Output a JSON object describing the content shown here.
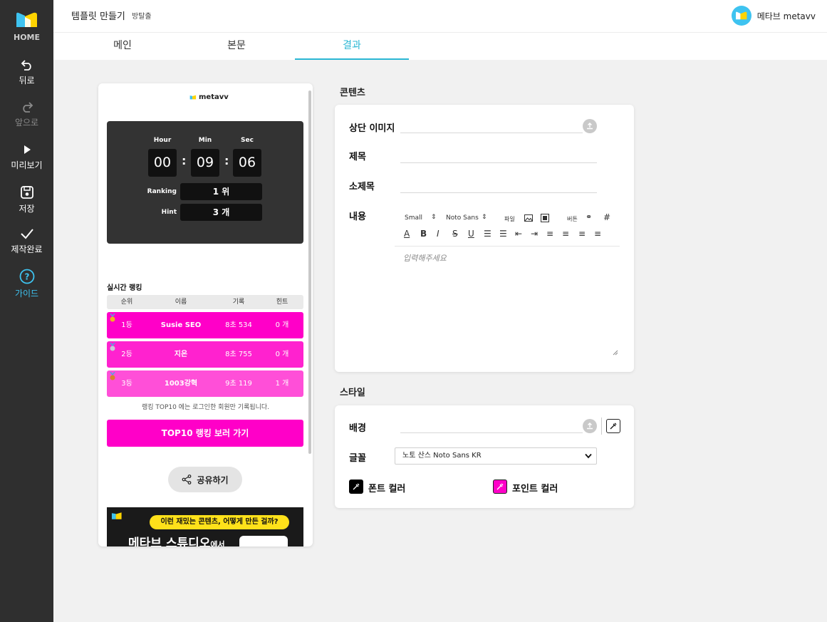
{
  "sidebar": {
    "home_label": "HOME",
    "items": [
      {
        "label": "뒤로",
        "icon": "undo-icon"
      },
      {
        "label": "앞으로",
        "icon": "redo-icon"
      },
      {
        "label": "미리보기",
        "icon": "play-icon"
      },
      {
        "label": "저장",
        "icon": "save-icon"
      },
      {
        "label": "제작완료",
        "icon": "check-icon"
      },
      {
        "label": "가이드",
        "icon": "help-icon"
      }
    ],
    "accent_color": "#3ec3f0"
  },
  "header": {
    "title": "템플릿 만들기",
    "subtitle": "방탈출",
    "user_name": "메타브 metavv"
  },
  "tabs": [
    {
      "label": "메인"
    },
    {
      "label": "본문"
    },
    {
      "label": "결과"
    }
  ],
  "preview": {
    "logo_text": "metavv",
    "timer": {
      "hour_label": "Hour",
      "min_label": "Min",
      "sec_label": "Sec",
      "hour": "00",
      "min": "09",
      "sec": "06",
      "ranking_label": "Ranking",
      "ranking_value": "1 위",
      "hint_label": "Hint",
      "hint_value": "3 개"
    },
    "ranking": {
      "title": "실시간 랭킹",
      "headers": [
        "순위",
        "이름",
        "기록",
        "힌트"
      ],
      "rows": [
        {
          "rank": "1등",
          "name": "Susie SEO",
          "record": "8초 534",
          "hint": "0 개",
          "color": "#ff00c8",
          "medal": "gold"
        },
        {
          "rank": "2등",
          "name": "지은",
          "record": "8초 755",
          "hint": "0 개",
          "color": "#ff22cf",
          "medal": "silver"
        },
        {
          "rank": "3등",
          "name": "1003강혁",
          "record": "9초 119",
          "hint": "1 개",
          "color": "#ff4fd8",
          "medal": "bronze"
        }
      ],
      "note": "랭킹 TOP10 에는 로그인한 회원만 기록됩니다.",
      "button_label": "TOP10 랭킹 보러 가기"
    },
    "share_label": "공유하기",
    "banner": {
      "bubble": "이런 재밌는 콘텐츠, 어떻게 만든 걸까?",
      "headline": "메타브 스튜디오",
      "headline_suffix": "에서"
    }
  },
  "content_section": {
    "title": "콘텐츠",
    "fields": {
      "top_image_label": "상단 이미지",
      "title_label": "제목",
      "subtitle_label": "소제목",
      "body_label": "내용"
    },
    "editor": {
      "size_select": "Small",
      "font_select": "Noto Sans",
      "file_label": "파일",
      "button_label": "버튼",
      "placeholder": "입력해주세요"
    }
  },
  "style_section": {
    "title": "스타일",
    "background_label": "배경",
    "font_label": "글꼴",
    "font_value": "노토 산스 Noto Sans KR",
    "font_color_label": "폰트 컬러",
    "point_color_label": "포인트 컬러",
    "font_color": "#000000",
    "point_color": "#ff00c8"
  }
}
